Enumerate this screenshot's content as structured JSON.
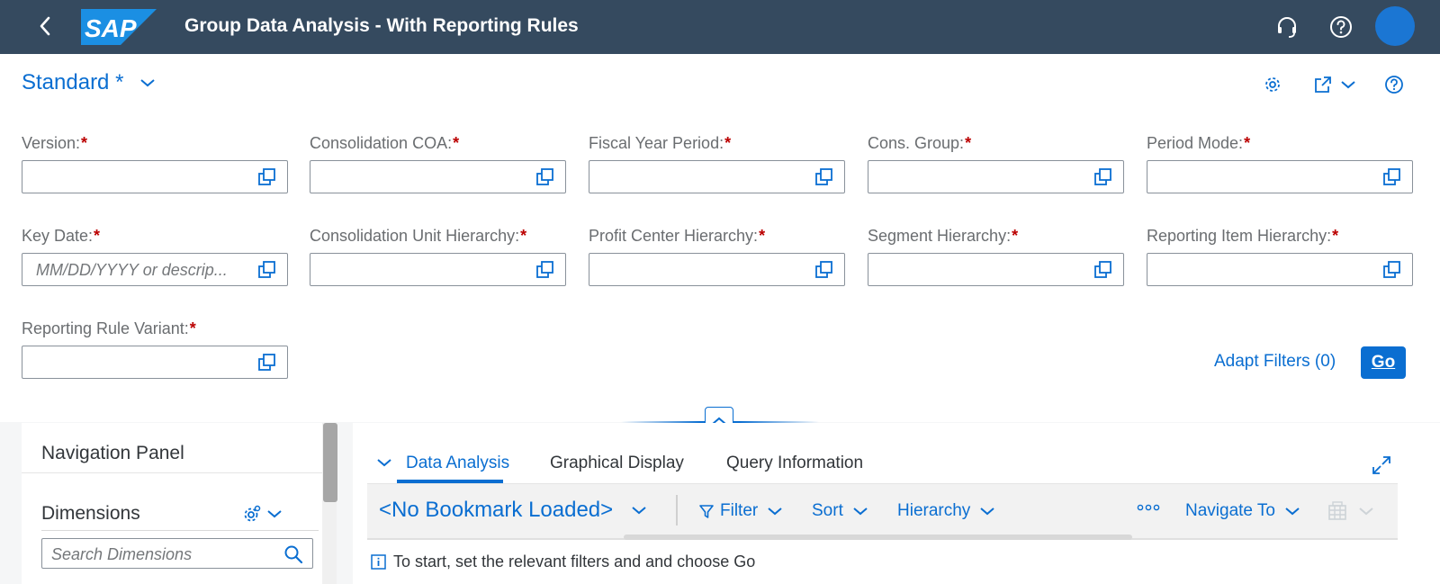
{
  "shell": {
    "title": "Group Data Analysis - With Reporting Rules",
    "logo_text": "SAP",
    "icons": [
      "back-icon",
      "headset-icon",
      "help-icon"
    ],
    "avatar_color": "#1b76d3",
    "bg_color": "#354a5f"
  },
  "variant": {
    "name": "Standard *"
  },
  "header_icons": [
    "settings-icon",
    "share-icon",
    "help-icon"
  ],
  "filters": [
    {
      "label": "Version:",
      "required": "*",
      "placeholder": ""
    },
    {
      "label": "Consolidation COA:",
      "required": "*",
      "placeholder": ""
    },
    {
      "label": "Fiscal Year Period:",
      "required": "*",
      "placeholder": ""
    },
    {
      "label": "Cons. Group:",
      "required": "*",
      "placeholder": ""
    },
    {
      "label": "Period Mode:",
      "required": "*",
      "placeholder": ""
    },
    {
      "label": "Key Date:",
      "required": "*",
      "placeholder": "MM/DD/YYYY or descrip..."
    },
    {
      "label": "Consolidation Unit Hierarchy:",
      "required": "*",
      "placeholder": ""
    },
    {
      "label": "Profit Center Hierarchy:",
      "required": "*",
      "placeholder": ""
    },
    {
      "label": "Segment Hierarchy:",
      "required": "*",
      "placeholder": ""
    },
    {
      "label": "Reporting Item Hierarchy:",
      "required": "*",
      "placeholder": ""
    },
    {
      "label": "Reporting Rule Variant:",
      "required": "*",
      "placeholder": ""
    }
  ],
  "filter_bar": {
    "adapt_filters": "Adapt Filters (0)",
    "go": "Go"
  },
  "nav_panel": {
    "title": "Navigation Panel",
    "dimensions_title": "Dimensions",
    "search_placeholder": "Search Dimensions"
  },
  "tabs": [
    {
      "label": "Data Analysis",
      "active": true
    },
    {
      "label": "Graphical Display",
      "active": false
    },
    {
      "label": "Query Information",
      "active": false
    }
  ],
  "toolbar": {
    "bookmark": "<No Bookmark Loaded>",
    "filter": "Filter",
    "sort": "Sort",
    "hierarchy": "Hierarchy",
    "navigate_to": "Navigate To"
  },
  "message": "To start, set the relevant filters and and choose Go",
  "colors": {
    "accent": "#0a6ed1",
    "required": "#bb0000",
    "shell": "#354a5f"
  }
}
